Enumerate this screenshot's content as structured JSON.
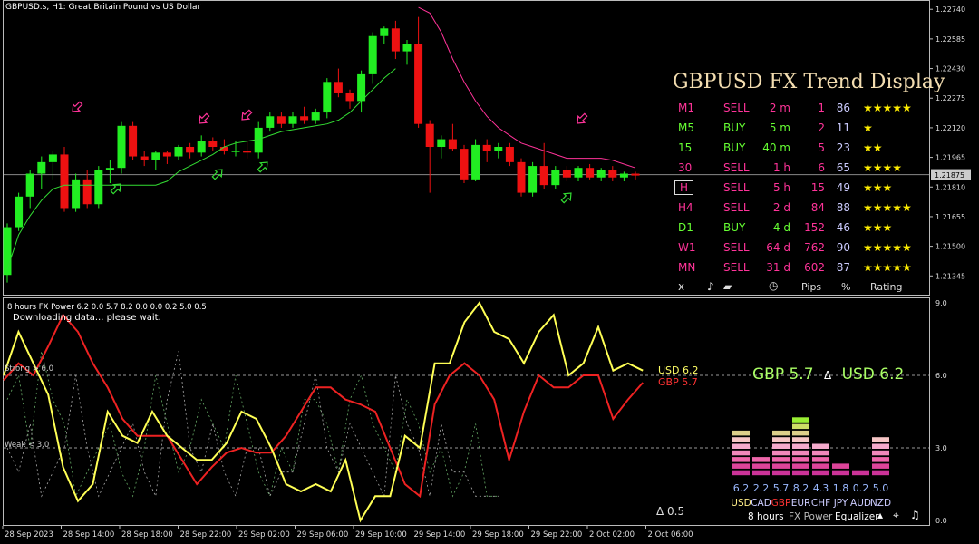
{
  "chart_header": {
    "symbol": "GBPUSD.s",
    "timeframe": "H1",
    "description": "Great Britain Pound vs US Dollar"
  },
  "price_axis": {
    "labels": [
      "1.22740",
      "1.22585",
      "1.22430",
      "1.22275",
      "1.22120",
      "1.21965",
      "1.21875",
      "1.21810",
      "1.21655",
      "1.21500",
      "1.21345"
    ],
    "current": "1.21875"
  },
  "time_axis": {
    "labels": [
      "28 Sep 2023",
      "28 Sep 14:00",
      "28 Sep 18:00",
      "28 Sep 22:00",
      "29 Sep 02:00",
      "29 Sep 06:00",
      "29 Sep 10:00",
      "29 Sep 14:00",
      "29 Sep 18:00",
      "29 Sep 22:00",
      "2 Oct 02:00",
      "2 Oct 06:00"
    ]
  },
  "trend_display": {
    "title": "GBPUSD FX Trend Display",
    "rows": [
      {
        "tf": "M1",
        "dir": "SELL",
        "dur": "2 m",
        "pips": "1",
        "pct": "86",
        "stars": "★★★★★"
      },
      {
        "tf": "M5",
        "dir": "BUY",
        "dur": "5 m",
        "pips": "2",
        "pct": "11",
        "stars": "★"
      },
      {
        "tf": "15",
        "dir": "BUY",
        "dur": "40 m",
        "pips": "5",
        "pct": "23",
        "stars": "★★"
      },
      {
        "tf": "30",
        "dir": "SELL",
        "dur": "1 h",
        "pips": "6",
        "pct": "65",
        "stars": "★★★★"
      },
      {
        "tf": "H",
        "dir": "SELL",
        "dur": "5 h",
        "pips": "15",
        "pct": "49",
        "stars": "★★★"
      },
      {
        "tf": "H4",
        "dir": "SELL",
        "dur": "2 d",
        "pips": "84",
        "pct": "88",
        "stars": "★★★★★"
      },
      {
        "tf": "D1",
        "dir": "BUY",
        "dur": "4 d",
        "pips": "152",
        "pct": "46",
        "stars": "★★★"
      },
      {
        "tf": "W1",
        "dir": "SELL",
        "dur": "64 d",
        "pips": "762",
        "pct": "90",
        "stars": "★★★★★"
      },
      {
        "tf": "MN",
        "dir": "SELL",
        "dur": "31 d",
        "pips": "602",
        "pct": "87",
        "stars": "★★★★★"
      }
    ],
    "footer": {
      "close": "x",
      "pips": "Pips",
      "pct": "%",
      "rating": "Rating"
    },
    "colors": {
      "sell": "#ff3399",
      "buy": "#66ff33",
      "pips": "#ff3399",
      "pct": "#ccccff",
      "star": "#ffee00"
    }
  },
  "indicator": {
    "title": "8 hours FX Power 6.2 0.0 5.7 8.2 0.0 0.0 0.2 5.0 0.5",
    "status": "Downloading data... please wait.",
    "strong": "Strong > 6.0",
    "weak": "Weak < 3.0",
    "axis": [
      "9.0",
      "6.0",
      "3.0",
      "0.0"
    ],
    "usd_label": "USD 6.2",
    "gbp_label": "GBP 5.7",
    "delta_label": "Δ 0.5",
    "headline_gbp": "GBP 5.7",
    "headline_delta": "Δ",
    "headline_usd": "USD 6.2",
    "toolbar": {
      "period": "8 hours",
      "name": "FX Power",
      "mode": "Equalizer"
    }
  },
  "chart_data": [
    {
      "type": "candlestick",
      "title": "GBPUSD.s, H1: Great Britain Pound vs US Dollar",
      "ylim": [
        1.2128,
        1.2276
      ],
      "candles": [
        [
          1.2135,
          1.2162,
          1.2131,
          1.216
        ],
        [
          1.216,
          1.2178,
          1.2158,
          1.2176
        ],
        [
          1.2176,
          1.219,
          1.217,
          1.2188
        ],
        [
          1.2188,
          1.2197,
          1.218,
          1.2194
        ],
        [
          1.2194,
          1.22,
          1.2185,
          1.2198
        ],
        [
          1.2198,
          1.2202,
          1.2168,
          1.217
        ],
        [
          1.217,
          1.2188,
          1.2168,
          1.2185
        ],
        [
          1.2185,
          1.219,
          1.217,
          1.2172
        ],
        [
          1.2172,
          1.2192,
          1.217,
          1.219
        ],
        [
          1.219,
          1.2195,
          1.2183,
          1.2191
        ],
        [
          1.2191,
          1.2215,
          1.2188,
          1.2213
        ],
        [
          1.2213,
          1.2215,
          1.2195,
          1.2197
        ],
        [
          1.2197,
          1.22,
          1.2192,
          1.2195
        ],
        [
          1.2195,
          1.22,
          1.219,
          1.2199
        ],
        [
          1.2199,
          1.22,
          1.2193,
          1.2197
        ],
        [
          1.2197,
          1.2203,
          1.2195,
          1.2202
        ],
        [
          1.2202,
          1.2204,
          1.2196,
          1.2199
        ],
        [
          1.2199,
          1.2208,
          1.2197,
          1.2205
        ],
        [
          1.2205,
          1.2207,
          1.22,
          1.2202
        ],
        [
          1.2202,
          1.2206,
          1.2198,
          1.22
        ],
        [
          1.22,
          1.2205,
          1.2197,
          1.22
        ],
        [
          1.22,
          1.2205,
          1.2196,
          1.2199
        ],
        [
          1.2199,
          1.2215,
          1.2196,
          1.2212
        ],
        [
          1.2212,
          1.222,
          1.221,
          1.2218
        ],
        [
          1.2218,
          1.222,
          1.2212,
          1.2214
        ],
        [
          1.2214,
          1.222,
          1.2212,
          1.2218
        ],
        [
          1.2218,
          1.2223,
          1.2214,
          1.2216
        ],
        [
          1.2216,
          1.2222,
          1.2214,
          1.222
        ],
        [
          1.222,
          1.2238,
          1.2217,
          1.2236
        ],
        [
          1.2236,
          1.2243,
          1.2228,
          1.223
        ],
        [
          1.223,
          1.2232,
          1.2222,
          1.2226
        ],
        [
          1.2226,
          1.2242,
          1.222,
          1.224
        ],
        [
          1.224,
          1.2262,
          1.2235,
          1.226
        ],
        [
          1.226,
          1.2265,
          1.2256,
          1.2264
        ],
        [
          1.2264,
          1.2268,
          1.2248,
          1.2252
        ],
        [
          1.2252,
          1.2258,
          1.2245,
          1.2256
        ],
        [
          1.2256,
          1.227,
          1.2212,
          1.2214
        ],
        [
          1.2214,
          1.2216,
          1.2178,
          1.2202
        ],
        [
          1.2202,
          1.2208,
          1.2196,
          1.2206
        ],
        [
          1.2206,
          1.2214,
          1.22,
          1.2201
        ],
        [
          1.2201,
          1.2203,
          1.2183,
          1.2185
        ],
        [
          1.2185,
          1.2206,
          1.2184,
          1.2203
        ],
        [
          1.2203,
          1.2206,
          1.2194,
          1.22
        ],
        [
          1.22,
          1.2204,
          1.2196,
          1.2202
        ],
        [
          1.2202,
          1.2204,
          1.2192,
          1.2194
        ],
        [
          1.2194,
          1.2196,
          1.2176,
          1.2178
        ],
        [
          1.2178,
          1.2194,
          1.2176,
          1.2192
        ],
        [
          1.2192,
          1.2204,
          1.218,
          1.2182
        ],
        [
          1.2182,
          1.2192,
          1.218,
          1.219
        ],
        [
          1.219,
          1.2192,
          1.2184,
          1.2186
        ],
        [
          1.2186,
          1.2192,
          1.2184,
          1.2191
        ],
        [
          1.2191,
          1.2193,
          1.2185,
          1.2186
        ],
        [
          1.2186,
          1.2191,
          1.2184,
          1.219
        ],
        [
          1.219,
          1.2192,
          1.2184,
          1.2186
        ],
        [
          1.2186,
          1.2189,
          1.2184,
          1.2188
        ],
        [
          1.2188,
          1.2189,
          1.2185,
          1.2187
        ]
      ],
      "support_line": [
        1.2138,
        1.2156,
        1.2166,
        1.2174,
        1.218,
        1.2182,
        1.2182,
        1.2182,
        1.2182,
        1.2182,
        1.2182,
        1.2182,
        1.2182,
        1.2182,
        1.2184,
        1.2189,
        1.2192,
        1.2195,
        1.2198,
        1.2202,
        1.2204,
        1.2205,
        1.2206,
        1.2208,
        1.221,
        1.2211,
        1.2212,
        1.2213,
        1.2214,
        1.2216,
        1.222,
        1.2226,
        1.2232,
        1.2238,
        1.2243
      ],
      "resistance_line": [
        1.2275,
        1.2272,
        1.2262,
        1.2248,
        1.2236,
        1.2226,
        1.2218,
        1.2212,
        1.2208,
        1.2204,
        1.2202,
        1.22,
        1.2198,
        1.2196,
        1.2196,
        1.2196,
        1.2196,
        1.2195,
        1.2193,
        1.2191
      ],
      "current_price": 1.21875
    },
    {
      "type": "line",
      "title": "8 hours FX Power",
      "ylim": [
        0,
        9
      ],
      "series": [
        {
          "name": "USD",
          "values": [
            6.0,
            7.8,
            6.5,
            5.2,
            2.2,
            0.8,
            1.5,
            4.5,
            3.5,
            3.2,
            4.5,
            3.5,
            3.0,
            2.5,
            2.5,
            3.2,
            4.5,
            4.2,
            3.0,
            1.5,
            1.2,
            1.5,
            1.2,
            2.5,
            0.0,
            1.0,
            1.0,
            3.5,
            3.0,
            6.5,
            6.5,
            8.2,
            9.0,
            7.8,
            7.5,
            6.5,
            7.8,
            8.5,
            6.0,
            6.5,
            8.0,
            6.2,
            6.5,
            6.2
          ]
        },
        {
          "name": "GBP",
          "values": [
            5.8,
            6.5,
            6.0,
            7.2,
            8.5,
            7.8,
            6.5,
            5.5,
            4.2,
            3.5,
            3.5,
            3.5,
            2.5,
            1.5,
            2.2,
            2.8,
            3.0,
            2.8,
            2.8,
            3.5,
            4.5,
            5.5,
            5.5,
            5.0,
            4.8,
            4.5,
            3.0,
            1.5,
            1.0,
            4.8,
            6.0,
            6.5,
            6.0,
            5.0,
            2.5,
            4.5,
            6.0,
            5.5,
            5.5,
            6.0,
            6.0,
            4.2,
            5.0,
            5.7
          ]
        }
      ]
    },
    {
      "type": "bar",
      "title": "FX Power Equalizer",
      "categories": [
        "USD",
        "CAD",
        "GBP",
        "EUR",
        "CHF",
        "JPY",
        "AUD",
        "NZD"
      ],
      "values": [
        6.2,
        2.2,
        5.7,
        8.2,
        4.3,
        1.8,
        0.2,
        5.0
      ],
      "value_labels": [
        "6.2",
        "2.2",
        "5.7",
        "8.2",
        "4.3",
        "1.8",
        "0.2",
        "5.0"
      ]
    }
  ]
}
